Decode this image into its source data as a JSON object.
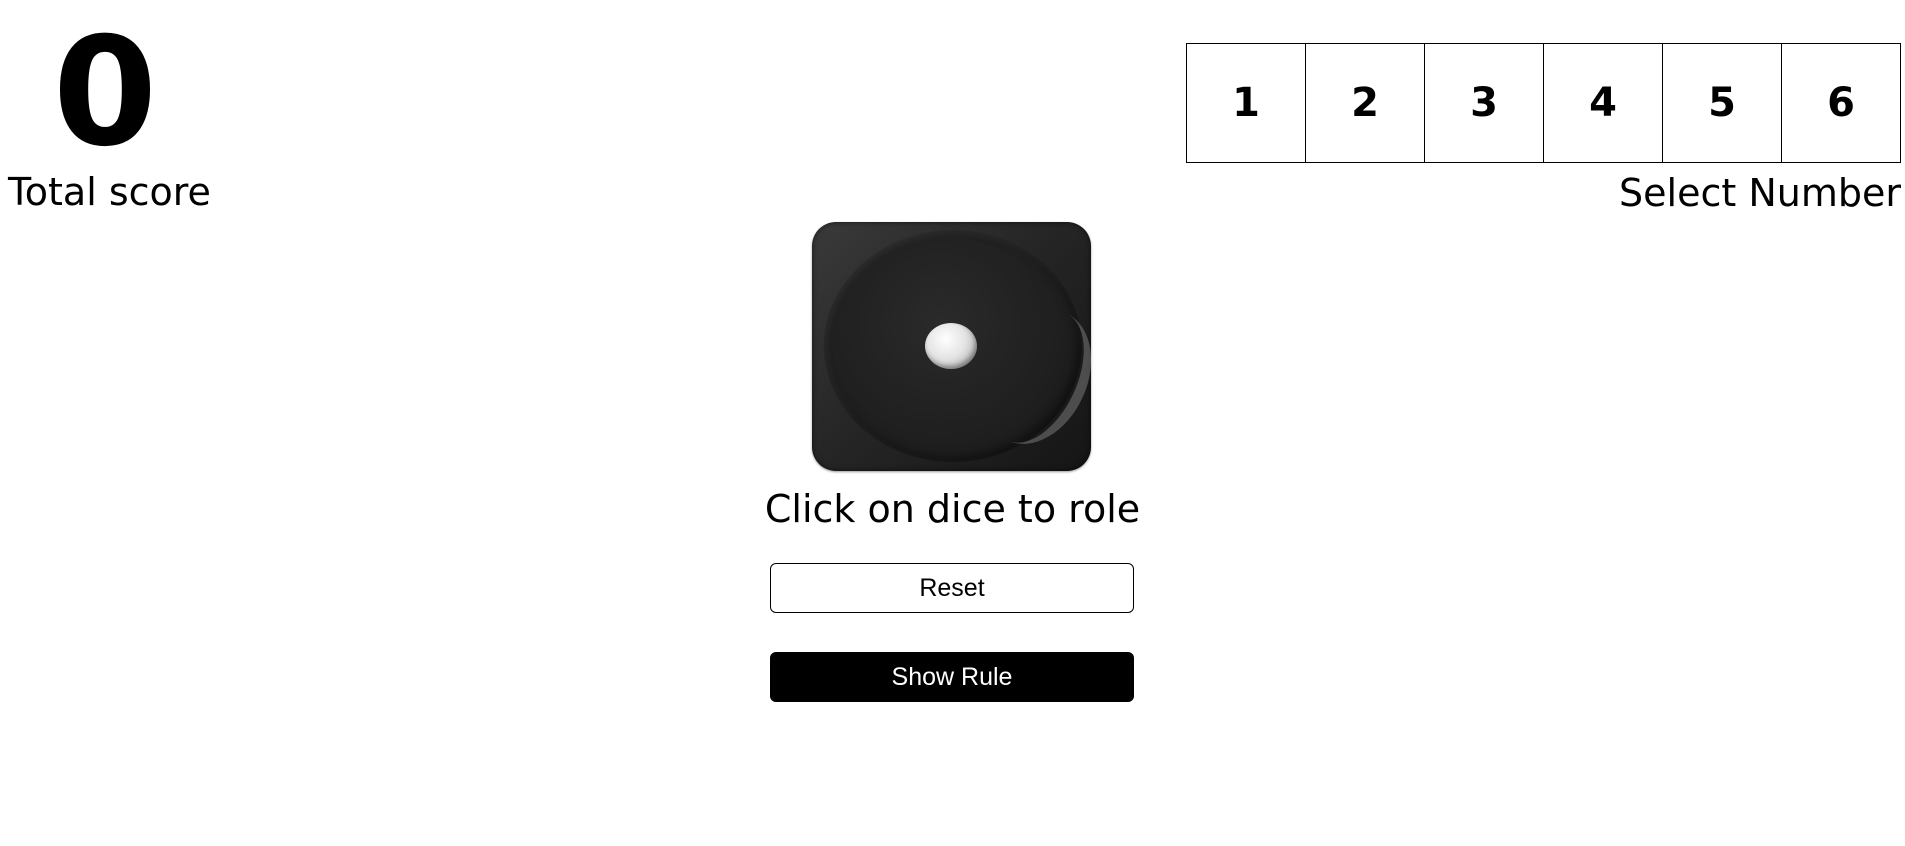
{
  "score": {
    "value": "0",
    "label": "Total score"
  },
  "selector": {
    "numbers": [
      "1",
      "2",
      "3",
      "4",
      "5",
      "6"
    ],
    "label": "Select Number"
  },
  "dice": {
    "current_face": 1,
    "hint": "Click on dice to role"
  },
  "buttons": {
    "reset_label": "Reset",
    "show_rule_label": "Show Rule"
  },
  "colors": {
    "background": "#ffffff",
    "text": "#000000",
    "primary_button": "#000000",
    "primary_button_text": "#ffffff"
  }
}
